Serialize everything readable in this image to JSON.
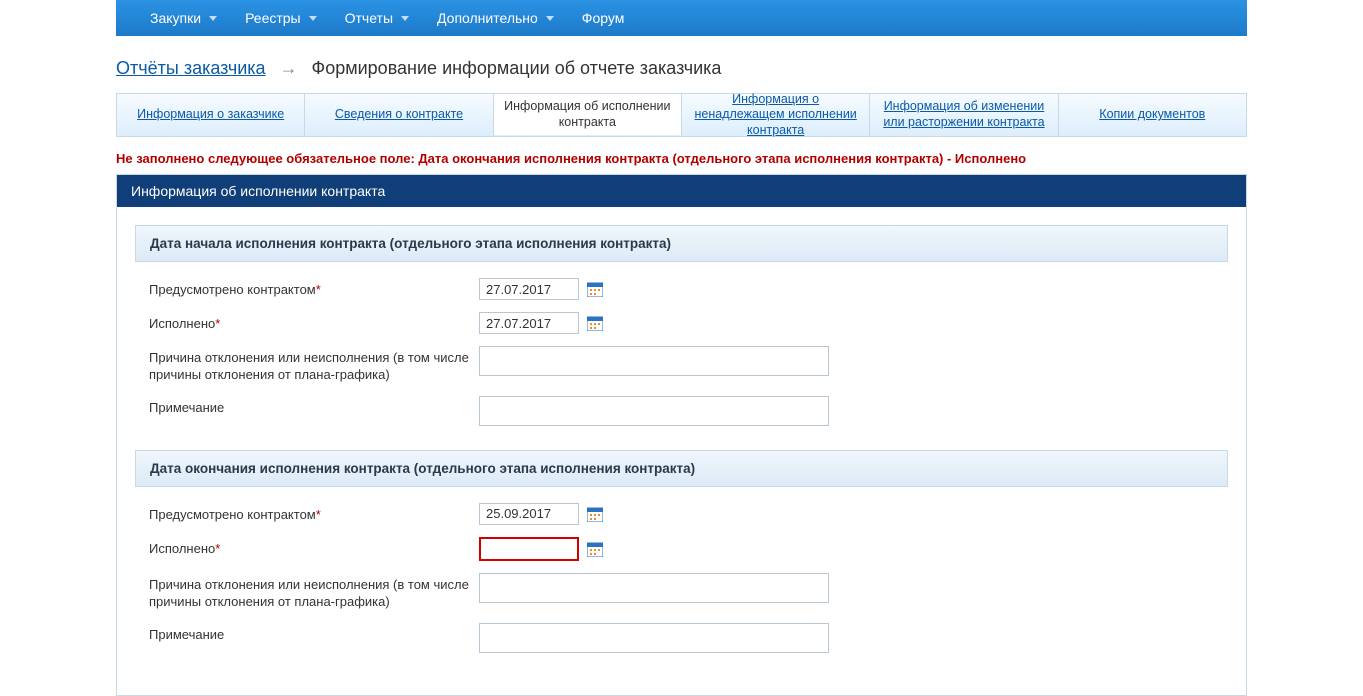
{
  "topnav": {
    "items": [
      "Закупки",
      "Реестры",
      "Отчеты",
      "Дополнительно"
    ],
    "last": "Форум"
  },
  "breadcrumb": {
    "link": "Отчёты заказчика",
    "current": "Формирование информации об отчете заказчика"
  },
  "tabs": [
    {
      "label": "Информация о заказчике",
      "active": false
    },
    {
      "label": "Сведения о контракте",
      "active": false
    },
    {
      "label": "Информация об исполнении контракта",
      "active": true
    },
    {
      "label": "Информация о ненадлежащем исполнении контракта",
      "active": false
    },
    {
      "label": "Информация об изменении или расторжении контракта",
      "active": false
    },
    {
      "label": "Копии документов",
      "active": false
    }
  ],
  "error": "Не заполнено следующее обязательное поле: Дата окончания исполнения контракта (отдельного этапа исполнения контракта) - Исполнено",
  "panel_title": "Информация об исполнении контракта",
  "section1": {
    "title": "Дата начала исполнения контракта (отдельного этапа исполнения контракта)",
    "rows": {
      "contract_label": "Предусмотрено контрактом",
      "contract_value": "27.07.2017",
      "done_label": "Исполнено",
      "done_value": "27.07.2017",
      "reason_label": "Причина отклонения или неисполнения (в том числе причины отклонения от плана-графика)",
      "reason_value": "",
      "note_label": "Примечание",
      "note_value": ""
    }
  },
  "section2": {
    "title": "Дата окончания исполнения контракта (отдельного этапа исполнения контракта)",
    "rows": {
      "contract_label": "Предусмотрено контрактом",
      "contract_value": "25.09.2017",
      "done_label": "Исполнено",
      "done_value": "",
      "reason_label": "Причина отклонения или неисполнения (в том числе причины отклонения от плана-графика)",
      "reason_value": "",
      "note_label": "Примечание",
      "note_value": ""
    }
  }
}
